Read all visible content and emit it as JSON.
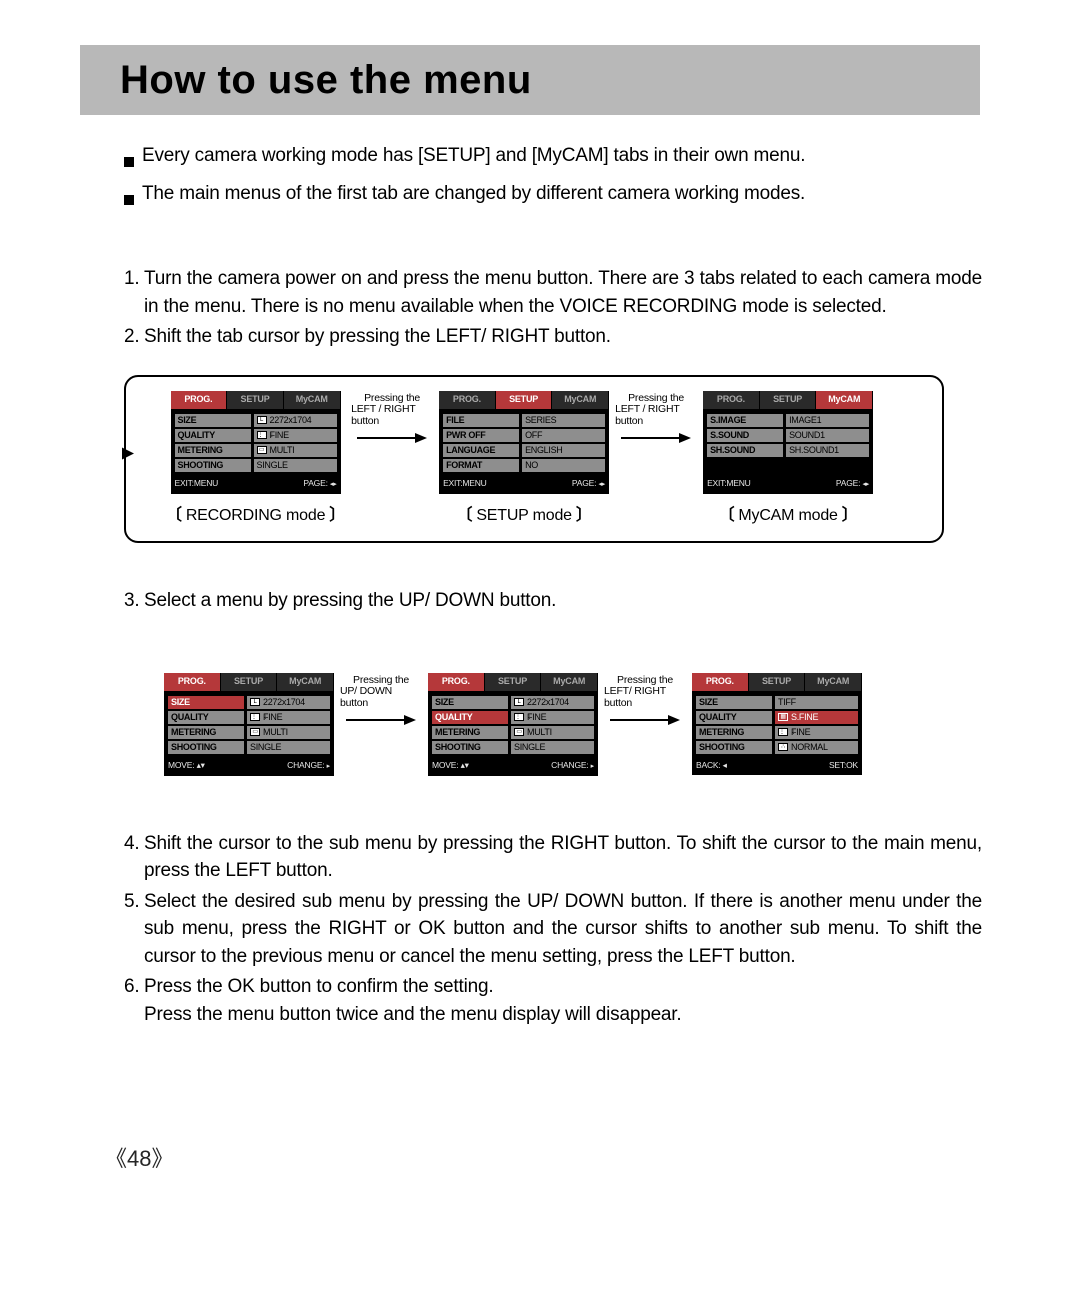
{
  "header": {
    "title": "How to use the menu"
  },
  "bullets": [
    "Every camera working mode has [SETUP] and [MyCAM] tabs in their own menu.",
    "The main menus of the first tab are changed by different camera working modes."
  ],
  "steps_a": [
    {
      "n": "1.",
      "t": "Turn the camera power on and press the menu button. There are 3 tabs related to each camera mode in the menu. There is no menu available when the VOICE RECORDING mode is selected."
    },
    {
      "n": "2.",
      "t": "Shift the tab cursor by pressing the LEFT/ RIGHT button."
    }
  ],
  "step3": {
    "n": "3.",
    "t": "Select a menu by pressing the UP/ DOWN button."
  },
  "steps_b": [
    {
      "n": "4.",
      "t": "Shift the cursor to the sub menu by pressing the RIGHT button. To shift the cursor to the main menu, press the LEFT button."
    },
    {
      "n": "5.",
      "t": "Select the desired sub menu by pressing the UP/ DOWN button. If there is another menu under the sub menu, press the RIGHT or OK button and the cursor shifts to another sub menu. To shift the cursor to the previous menu or cancel the menu setting, press the LEFT button."
    },
    {
      "n": "6.",
      "t": "Press the OK button to confirm the setting.",
      "t2": "Press the menu button twice and the menu display will disappear."
    }
  ],
  "arrows": {
    "a1": {
      "l1": "Pressing the",
      "l2": "LEFT / RIGHT button"
    },
    "a2": {
      "l1": "Pressing the",
      "l2": "UP/ DOWN button"
    },
    "a3": {
      "l1": "Pressing the",
      "l2": "LEFT/ RIGHT button"
    }
  },
  "captions": {
    "rec": "RECORDING mode",
    "setup": "SETUP mode",
    "mycam": "MyCAM mode"
  },
  "tabs": {
    "prog": "PROG.",
    "setup": "SETUP",
    "mycam": "MyCAM"
  },
  "footers": {
    "exit": "EXIT:MENU",
    "page": "PAGE:",
    "move": "MOVE:",
    "change": "CHANGE:",
    "back": "BACK:",
    "setok": "SET:OK"
  },
  "lcd1": {
    "active": "prog",
    "rows": [
      {
        "label": "SIZE",
        "val": "2272x1704",
        "icon": "L"
      },
      {
        "label": "QUALITY",
        "val": "FINE",
        "icon": "⋮⋮⋮"
      },
      {
        "label": "METERING",
        "val": "MULTI",
        "icon": "▭"
      },
      {
        "label": "SHOOTING",
        "val": "SINGLE",
        "icon": ""
      }
    ]
  },
  "lcd2": {
    "active": "setup",
    "rows": [
      {
        "label": "FILE",
        "val": "SERIES"
      },
      {
        "label": "PWR OFF",
        "val": "OFF"
      },
      {
        "label": "LANGUAGE",
        "val": "ENGLISH"
      },
      {
        "label": "FORMAT",
        "val": "NO"
      }
    ]
  },
  "lcd3": {
    "active": "mycam",
    "rows": [
      {
        "label": "S.IMAGE",
        "val": "IMAGE1"
      },
      {
        "label": "S.SOUND",
        "val": "SOUND1"
      },
      {
        "label": "SH.SOUND",
        "val": "SH.SOUND1"
      }
    ]
  },
  "lcd4": {
    "active": "prog",
    "hlRow": 0,
    "hlSide": "label",
    "rows": [
      {
        "label": "SIZE",
        "val": "2272x1704",
        "icon": "L"
      },
      {
        "label": "QUALITY",
        "val": "FINE",
        "icon": "⋮⋮⋮"
      },
      {
        "label": "METERING",
        "val": "MULTI",
        "icon": "▭"
      },
      {
        "label": "SHOOTING",
        "val": "SINGLE",
        "icon": ""
      }
    ]
  },
  "lcd5": {
    "active": "prog",
    "hlRow": 1,
    "hlSide": "label",
    "rows": [
      {
        "label": "SIZE",
        "val": "2272x1704",
        "icon": "L"
      },
      {
        "label": "QUALITY",
        "val": "FINE",
        "icon": "⋮⋮⋮"
      },
      {
        "label": "METERING",
        "val": "MULTI",
        "icon": "▭"
      },
      {
        "label": "SHOOTING",
        "val": "SINGLE",
        "icon": ""
      }
    ]
  },
  "lcd6": {
    "active": "prog",
    "hlRow": 1,
    "hlSide": "val",
    "rows": [
      {
        "label": "SIZE",
        "val": "TIFF",
        "icon": ""
      },
      {
        "label": "QUALITY",
        "val": "S.FINE",
        "icon": "▦"
      },
      {
        "label": "METERING",
        "val": "FINE",
        "icon": "⋮⋮⋮"
      },
      {
        "label": "SHOOTING",
        "val": "NORMAL",
        "icon": "∴"
      }
    ]
  },
  "pagenum": "48"
}
